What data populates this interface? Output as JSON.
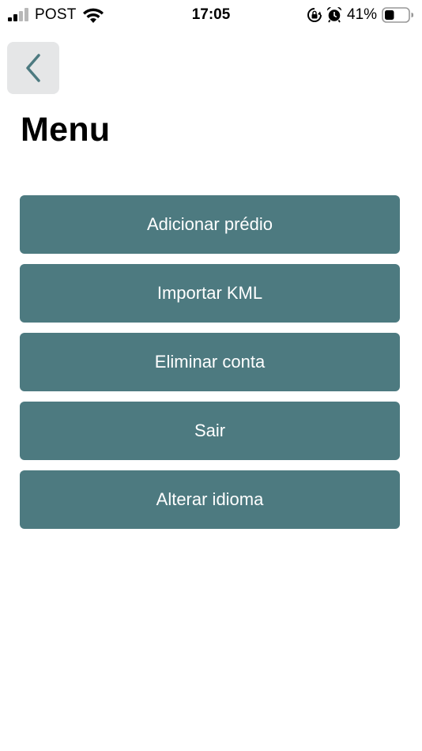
{
  "status_bar": {
    "carrier": "POST",
    "time": "17:05",
    "battery_percent": "41%",
    "signal_icon": "signal-bars-icon",
    "wifi_icon": "wifi-icon",
    "rotation_lock_icon": "rotation-lock-icon",
    "alarm_icon": "alarm-clock-icon",
    "battery_icon": "battery-icon",
    "battery_level": 0.41
  },
  "header": {
    "back_icon": "chevron-left-icon",
    "title": "Menu"
  },
  "menu": {
    "items": [
      {
        "label": "Adicionar prédio"
      },
      {
        "label": "Importar KML"
      },
      {
        "label": "Eliminar conta"
      },
      {
        "label": "Sair"
      },
      {
        "label": "Alterar idioma"
      }
    ]
  },
  "colors": {
    "button_bg": "#4d7a80",
    "back_button_bg": "#e5e6e7",
    "back_chevron": "#4d7a80",
    "text_dark": "#000000",
    "text_light": "#ffffff",
    "signal_active": "#000000",
    "signal_inactive": "#b8b8b8"
  }
}
